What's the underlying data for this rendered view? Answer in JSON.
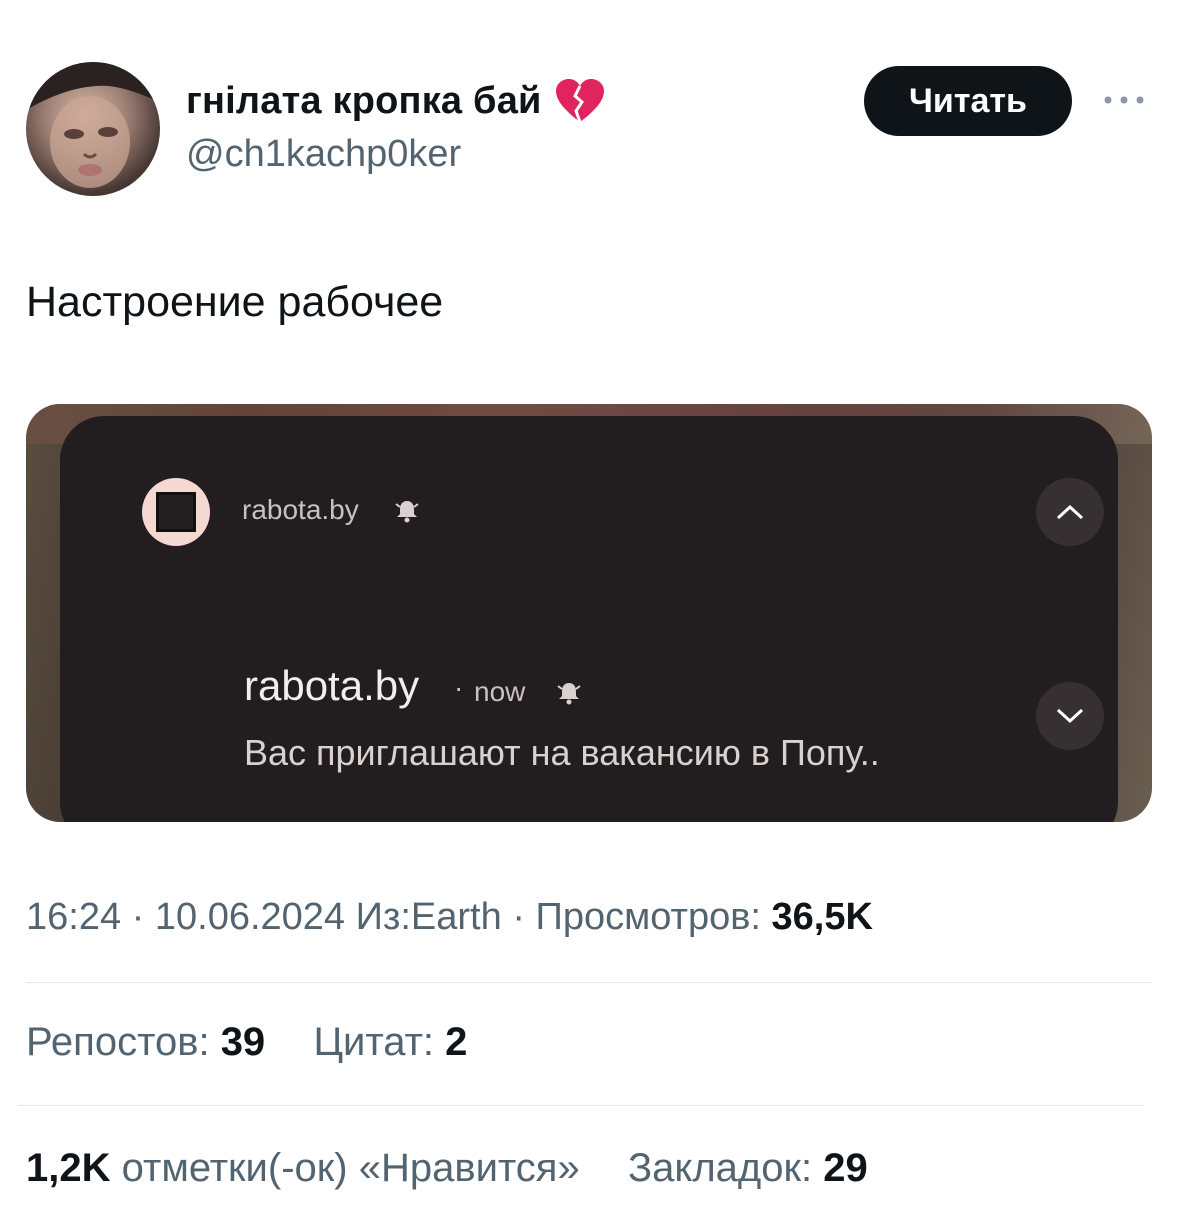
{
  "tweet": {
    "author": {
      "display_name": "гнілата кропка бай",
      "handle": "@ch1kachp0ker",
      "badge_emoji": "broken-heart-icon"
    },
    "follow_label": "Читать",
    "more_icon": "more-horizontal-icon",
    "text": "Настроение рабочее"
  },
  "media": {
    "app_name_small": "rabota.by",
    "notification": {
      "title": "rabota.by",
      "separator": "·",
      "time": "now",
      "body": "Вас приглашают на вакансию в Попу.."
    },
    "icons": [
      "bell-icon",
      "chevron-up-icon",
      "chevron-down-icon"
    ]
  },
  "meta": {
    "time": "16:24",
    "sep1": "·",
    "date": "10.06.2024",
    "source": "Из:Earth",
    "sep2": "·",
    "views_label": "Просмотров:",
    "views_value": "36,5K"
  },
  "stats": {
    "reposts_label": "Репостов:",
    "reposts_value": "39",
    "quotes_label": "Цитат:",
    "quotes_value": "2",
    "likes_value": "1,2K",
    "likes_label": "отметки(-ок) «Нравится»",
    "bookmarks_label": "Закладок:",
    "bookmarks_value": "29"
  },
  "colors": {
    "text_primary": "#0f1419",
    "text_secondary": "#536471",
    "button_bg": "#0f1419",
    "notif_panel": "#221e1f"
  }
}
